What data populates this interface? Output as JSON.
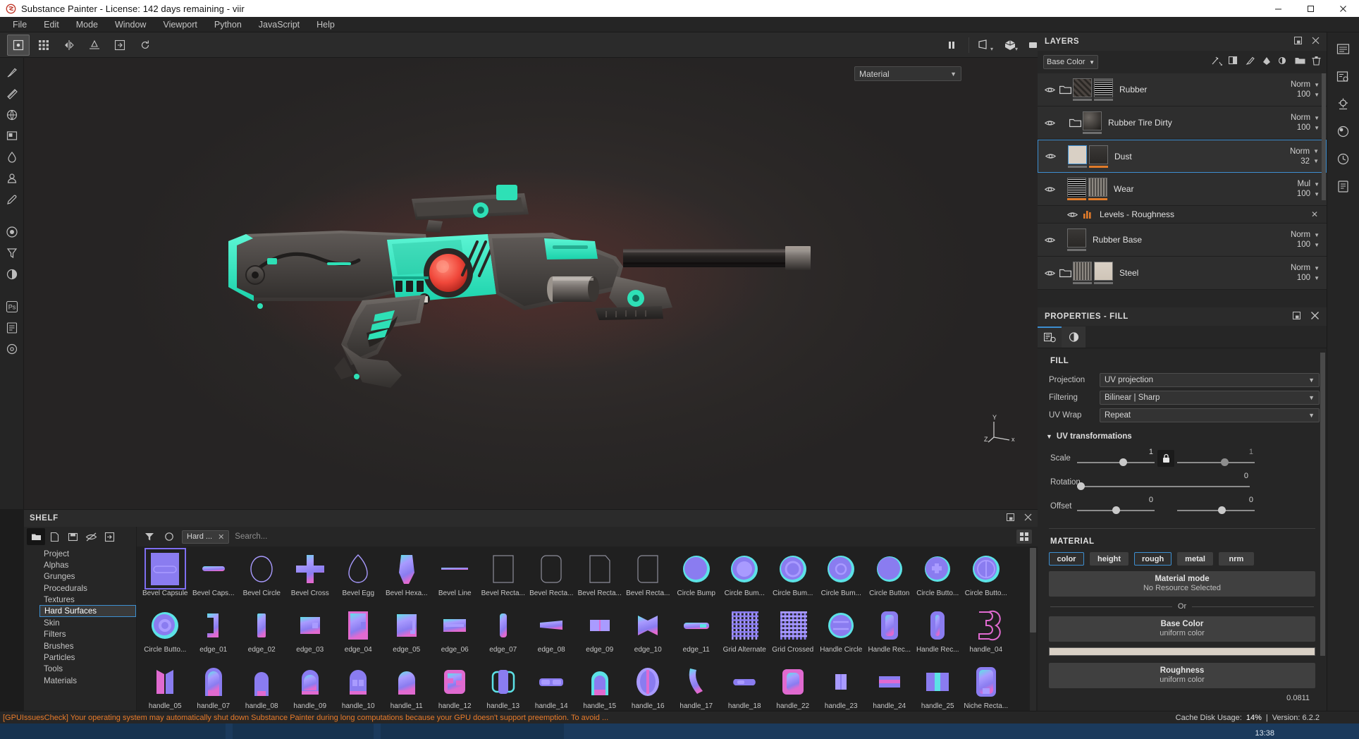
{
  "window": {
    "title": "Substance Painter - License: 142 days remaining - viir",
    "minimize": "—",
    "maximize": "☐",
    "close": "✕"
  },
  "menu": [
    "File",
    "Edit",
    "Mode",
    "Window",
    "Viewport",
    "Python",
    "JavaScript",
    "Help"
  ],
  "viewport": {
    "material_dropdown": "Material",
    "axis_x": "X",
    "axis_y": "Y",
    "axis_z": "Z"
  },
  "shelf": {
    "title": "SHELF",
    "search_placeholder": "Search...",
    "tag": "Hard ...",
    "categories": [
      "Project",
      "Alphas",
      "Grunges",
      "Procedurals",
      "Textures",
      "Hard Surfaces",
      "Skin",
      "Filters",
      "Brushes",
      "Particles",
      "Tools",
      "Materials"
    ],
    "selected_category": "Hard Surfaces",
    "items": [
      {
        "label": "Bevel Capsule",
        "icon": "bevel-capsule",
        "selected": true
      },
      {
        "label": "Bevel Caps...",
        "icon": "bevel-capsule-flat"
      },
      {
        "label": "Bevel Circle",
        "icon": "bevel-circle"
      },
      {
        "label": "Bevel Cross",
        "icon": "bevel-cross"
      },
      {
        "label": "Bevel Egg",
        "icon": "bevel-egg"
      },
      {
        "label": "Bevel Hexa...",
        "icon": "bevel-hexagon"
      },
      {
        "label": "Bevel Line",
        "icon": "bevel-line"
      },
      {
        "label": "Bevel Recta...",
        "icon": "bevel-rect-1"
      },
      {
        "label": "Bevel Recta...",
        "icon": "bevel-rect-2"
      },
      {
        "label": "Bevel Recta...",
        "icon": "bevel-rect-3"
      },
      {
        "label": "Bevel Recta...",
        "icon": "bevel-rect-4"
      },
      {
        "label": "Circle Bump",
        "icon": "circle-bump-1"
      },
      {
        "label": "Circle Bum...",
        "icon": "circle-bump-2"
      },
      {
        "label": "Circle Bum...",
        "icon": "circle-bump-3"
      },
      {
        "label": "Circle Bum...",
        "icon": "circle-bump-4"
      },
      {
        "label": "Circle Button",
        "icon": "circle-button-1"
      },
      {
        "label": "Circle Butto...",
        "icon": "circle-button-2"
      },
      {
        "label": "Circle Butto...",
        "icon": "circle-button-3"
      },
      {
        "label": "Circle Butto...",
        "icon": "circle-button-4"
      },
      {
        "label": "edge_01",
        "icon": "edge-01"
      },
      {
        "label": "edge_02",
        "icon": "edge-02"
      },
      {
        "label": "edge_03",
        "icon": "edge-03"
      },
      {
        "label": "edge_04",
        "icon": "edge-04"
      },
      {
        "label": "edge_05",
        "icon": "edge-05"
      },
      {
        "label": "edge_06",
        "icon": "edge-06"
      },
      {
        "label": "edge_07",
        "icon": "edge-07"
      },
      {
        "label": "edge_08",
        "icon": "edge-08"
      },
      {
        "label": "edge_09",
        "icon": "edge-09"
      },
      {
        "label": "edge_10",
        "icon": "edge-10"
      },
      {
        "label": "edge_11",
        "icon": "edge-11"
      },
      {
        "label": "Grid Alternate",
        "icon": "grid-alternate"
      },
      {
        "label": "Grid Crossed",
        "icon": "grid-crossed"
      },
      {
        "label": "Handle Circle",
        "icon": "handle-circle"
      },
      {
        "label": "Handle Rec...",
        "icon": "handle-rect-1"
      },
      {
        "label": "Handle Rec...",
        "icon": "handle-rect-2"
      },
      {
        "label": "handle_04",
        "icon": "handle-04"
      },
      {
        "label": "handle_05",
        "icon": "handle-05"
      },
      {
        "label": "handle_07",
        "icon": "handle-07"
      },
      {
        "label": "handle_08",
        "icon": "handle-08"
      },
      {
        "label": "handle_09",
        "icon": "handle-09"
      },
      {
        "label": "handle_10",
        "icon": "handle-10"
      },
      {
        "label": "handle_11",
        "icon": "handle-11"
      },
      {
        "label": "handle_12",
        "icon": "handle-12"
      },
      {
        "label": "handle_13",
        "icon": "handle-13"
      },
      {
        "label": "handle_14",
        "icon": "handle-14"
      },
      {
        "label": "handle_15",
        "icon": "handle-15"
      },
      {
        "label": "handle_16",
        "icon": "handle-16"
      },
      {
        "label": "handle_17",
        "icon": "handle-17"
      },
      {
        "label": "handle_18",
        "icon": "handle-18"
      },
      {
        "label": "handle_22",
        "icon": "handle-22"
      },
      {
        "label": "handle_23",
        "icon": "handle-23"
      },
      {
        "label": "handle_24",
        "icon": "handle-24"
      },
      {
        "label": "handle_25",
        "icon": "handle-25"
      },
      {
        "label": "Niche Recta...",
        "icon": "niche-rect"
      }
    ]
  },
  "layers": {
    "title": "LAYERS",
    "channel": "Base Color",
    "rows": [
      {
        "name": "Rubber",
        "blend": "Norm",
        "opacity": "100",
        "type": "folder",
        "thumbs": 2,
        "selected": false,
        "indent": 0
      },
      {
        "name": "Rubber Tire Dirty",
        "blend": "Norm",
        "opacity": "100",
        "type": "folder",
        "thumbs": 1,
        "selected": false,
        "indent": 1
      },
      {
        "name": "Dust",
        "blend": "Norm",
        "opacity": "32",
        "type": "fill",
        "thumbs": 2,
        "selected": true,
        "indent": 1
      },
      {
        "name": "Wear",
        "blend": "Mul",
        "opacity": "100",
        "type": "fill",
        "thumbs": 2,
        "selected": false,
        "indent": 1
      },
      {
        "name": "Levels - Roughness",
        "blend": "",
        "opacity": "",
        "type": "effect",
        "thumbs": 0,
        "selected": false,
        "indent": 2
      },
      {
        "name": "Rubber Base",
        "blend": "Norm",
        "opacity": "100",
        "type": "fill",
        "thumbs": 1,
        "selected": false,
        "indent": 1
      },
      {
        "name": "Steel",
        "blend": "Norm",
        "opacity": "100",
        "type": "folder",
        "thumbs": 2,
        "selected": false,
        "indent": 0
      }
    ]
  },
  "properties": {
    "title": "PROPERTIES - FILL",
    "fill_section": "FILL",
    "projection_label": "Projection",
    "projection_value": "UV projection",
    "filtering_label": "Filtering",
    "filtering_value": "Bilinear | Sharp",
    "uvwrap_label": "UV Wrap",
    "uvwrap_value": "Repeat",
    "uv_group": "UV transformations",
    "scale_label": "Scale",
    "scale_value_u": "1",
    "scale_value_v": "1",
    "rotation_label": "Rotation",
    "rotation_value": "0",
    "offset_label": "Offset",
    "offset_value_u": "0",
    "offset_value_v": "0",
    "material_section": "MATERIAL",
    "channels": [
      {
        "label": "color",
        "on": true
      },
      {
        "label": "height",
        "on": false
      },
      {
        "label": "rough",
        "on": true
      },
      {
        "label": "metal",
        "on": false
      },
      {
        "label": "nrm",
        "on": false
      }
    ],
    "material_mode_title": "Material mode",
    "material_mode_sub": "No Resource Selected",
    "or_text": "Or",
    "basecolor_title": "Base Color",
    "basecolor_sub": "uniform color",
    "basecolor_hex": "#d9d0c5",
    "roughness_title": "Roughness",
    "roughness_sub": "uniform color",
    "roughness_value": "0.0811"
  },
  "status": {
    "warning": "[GPUIssuesCheck] Your operating system may automatically shut down Substance Painter during long computations because your GPU doesn't support preemption. To avoid ...",
    "cache_label": "Cache Disk Usage:",
    "cache_value": "14%",
    "sep": "|",
    "version": "Version: 6.2.2",
    "clock": "13:38"
  },
  "colors": {
    "accent_blue": "#3d8fd1",
    "accent_orange": "#e87b2a",
    "panel_bg": "#262626",
    "viewport_bg": "#2c2c2c"
  }
}
